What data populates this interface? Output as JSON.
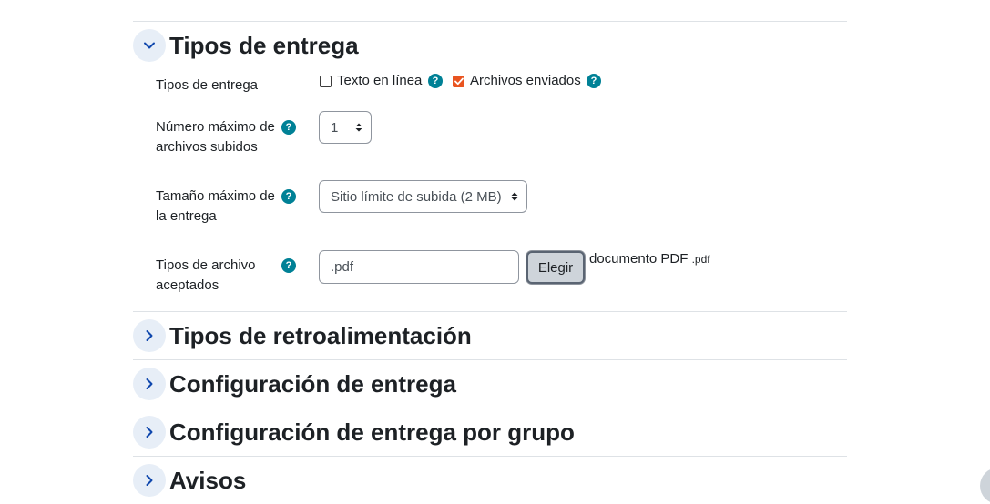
{
  "sections": {
    "entrega": {
      "title": "Tipos de entrega",
      "expanded": true
    },
    "retro": {
      "title": "Tipos de retroalimentación",
      "expanded": false
    },
    "config": {
      "title": "Configuración de entrega",
      "expanded": false
    },
    "grupo": {
      "title": "Configuración de entrega por grupo",
      "expanded": false
    },
    "avisos": {
      "title": "Avisos",
      "expanded": false
    }
  },
  "fields": {
    "tipos_entrega": {
      "label": "Tipos de entrega",
      "options": [
        {
          "label": "Texto en línea",
          "checked": false
        },
        {
          "label": "Archivos enviados",
          "checked": true
        }
      ]
    },
    "max_archivos": {
      "label_line1": "Número máximo de",
      "label_line2": "archivos subidos",
      "value": "1"
    },
    "max_tamano": {
      "label_line1": "Tamaño máximo de",
      "label_line2": "la entrega",
      "value": "Sitio límite de subida (2 MB)"
    },
    "tipos_archivo": {
      "label_line1": "Tipos de archivo",
      "label_line2": "aceptados",
      "value": ".pdf",
      "button_label": "Elegir",
      "type_name": "documento PDF",
      "type_ext": ".pdf"
    }
  },
  "help_glyph": "?",
  "colors": {
    "accent": "#e95420",
    "help": "#008196",
    "chevron_bg": "#e7eef7"
  }
}
